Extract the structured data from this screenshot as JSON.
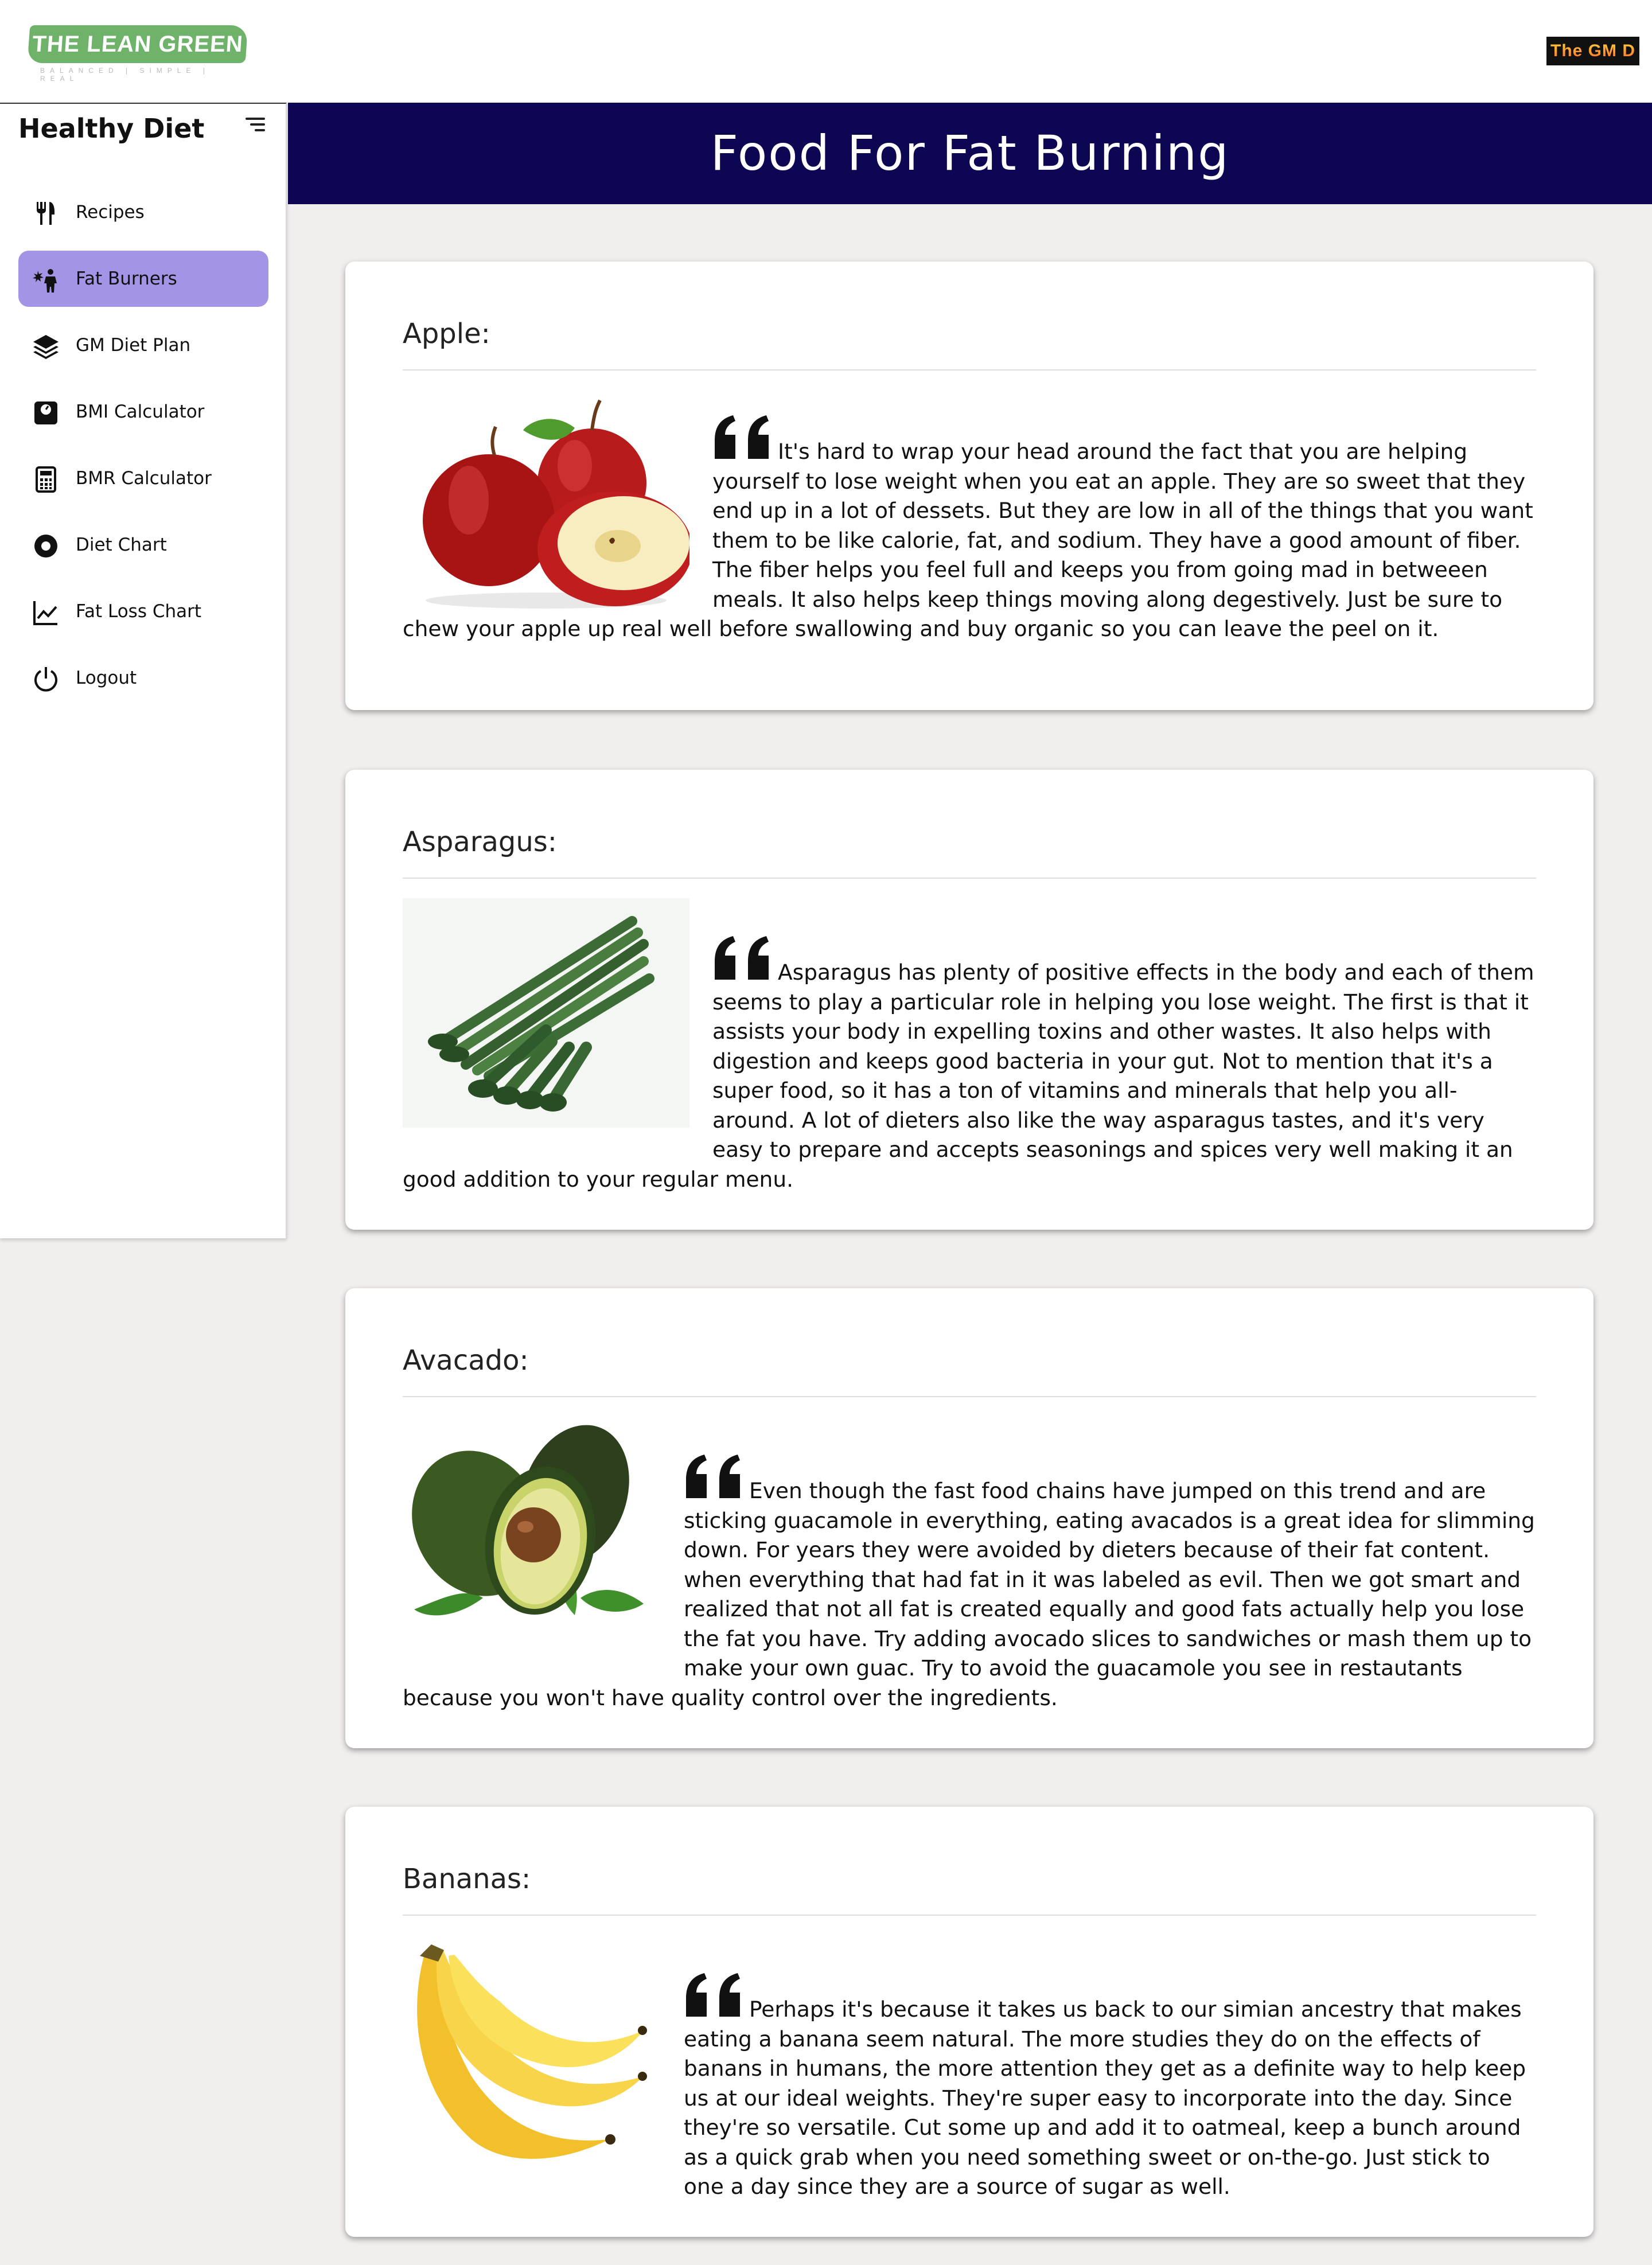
{
  "logo": {
    "title": "THE LEAN GREEN BEAN",
    "tagline": "BALANCED | SIMPLE | REAL"
  },
  "badge": {
    "text": "The GM D"
  },
  "sidebar": {
    "title": "Healthy Diet",
    "toggle_icon": "menu-icon",
    "items": [
      {
        "label": "Recipes",
        "icon": "fork-knife-icon",
        "active": false
      },
      {
        "label": "Fat Burners",
        "icon": "fat-burner-icon",
        "active": true
      },
      {
        "label": "GM Diet Plan",
        "icon": "layers-icon",
        "active": false
      },
      {
        "label": "BMI Calculator",
        "icon": "scale-icon",
        "active": false
      },
      {
        "label": "BMR Calculator",
        "icon": "calculator-icon",
        "active": false
      },
      {
        "label": "Diet Chart",
        "icon": "record-icon",
        "active": false
      },
      {
        "label": "Fat Loss Chart",
        "icon": "line-chart-icon",
        "active": false
      },
      {
        "label": "Logout",
        "icon": "power-icon",
        "active": false
      }
    ]
  },
  "header": {
    "title": "Food For Fat Burning"
  },
  "colors": {
    "header_bg": "#0d0652",
    "active_item": "#a394e6",
    "page_bg": "#f1eeee"
  },
  "cards": [
    {
      "title": "Apple:",
      "image": "apple-image",
      "text": "It's hard to wrap your head around the fact that you are helping yourself to lose weight when you eat an apple. They are so sweet that they end up in a lot of dessets. But they are low in all of the things that you want them to be like calorie, fat, and sodium. They have a good amount of fiber. The fiber helps you feel full and keeps you from going mad in betweeen meals. It also helps keep things moving along degestively. Just be sure to chew your apple up real well before swallowing and buy organic so you can leave the peel on it."
    },
    {
      "title": "Asparagus:",
      "image": "asparagus-image",
      "text": "Asparagus has plenty of positive effects in the body and each of them seems to play a particular role in helping you lose weight. The first is that it assists your body in expelling toxins and other wastes. It also helps with digestion and keeps good bacteria in your gut. Not to mention that it's a super food, so it has a ton of vitamins and minerals that help you all-around. A lot of dieters also like the way asparagus tastes, and it's very easy to prepare and accepts seasonings and spices very well making it an good addition to your regular menu."
    },
    {
      "title": "Avacado:",
      "image": "avocado-image",
      "text": "Even though the fast food chains have jumped on this trend and are sticking guacamole in everything, eating avacados is a great idea for slimming down. For years they were avoided by dieters because of their fat content. when everything that had fat in it was labeled as evil. Then we got smart and realized that not all fat is created equally and good fats actually help you lose the fat you have. Try adding avocado slices to sandwiches or mash them up to make your own guac. Try to avoid the guacamole you see in restautants because you won't have quality control over the ingredients."
    },
    {
      "title": "Bananas:",
      "image": "banana-image",
      "text": "Perhaps it's because it takes us back to our simian ancestry that makes eating a banana seem natural. The more studies they do on the effects of banans in humans, the more attention they get as a definite way to help keep us at our ideal weights. They're super easy to incorporate into the day. Since they're so versatile. Cut some up and add it to oatmeal, keep a bunch around as a quick grab when you need something sweet or on-the-go. Just stick to one a day since they are a source of sugar as well."
    }
  ]
}
